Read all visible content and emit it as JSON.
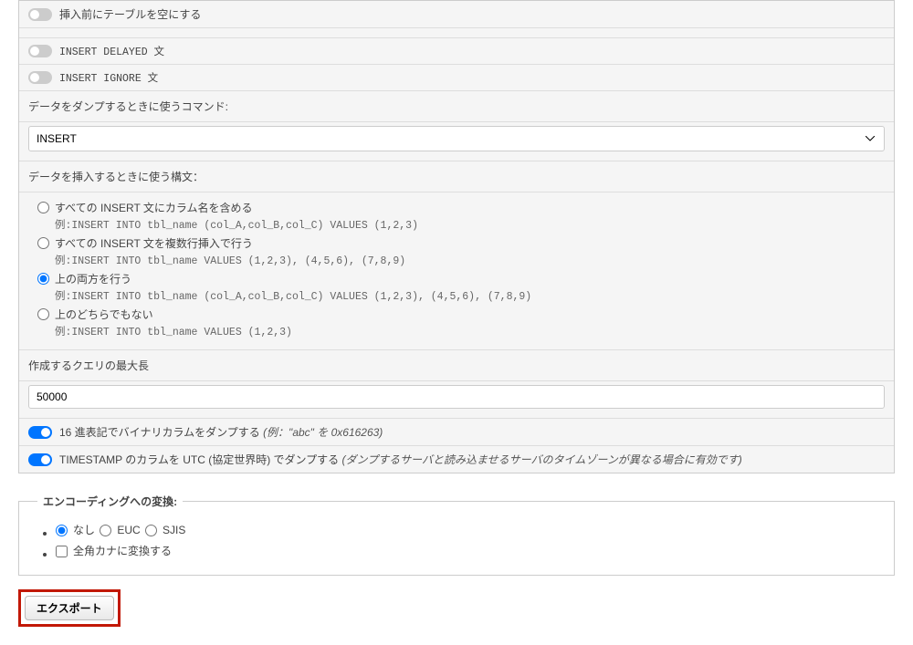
{
  "toggles": {
    "truncate_before": {
      "label": "挿入前にテーブルを空にする",
      "on": false
    },
    "insert_delayed": {
      "label": "INSERT DELAYED 文",
      "on": false
    },
    "insert_ignore": {
      "label": "INSERT IGNORE 文",
      "on": false
    },
    "hex_binary": {
      "label": "16 進表記でバイナリカラムをダンプする ",
      "hint": "(例：\"abc\" を 0x616263)",
      "on": true
    },
    "timestamp_utc": {
      "label": "TIMESTAMP のカラムを UTC (協定世界時) でダンプする ",
      "hint": "(ダンプするサーバと読み込ませるサーバのタイムゾーンが異なる場合に有効です)",
      "on": true
    }
  },
  "dump_command": {
    "label": "データをダンプするときに使うコマンド:",
    "value": "INSERT"
  },
  "insert_syntax": {
    "label": "データを挿入するときに使う構文：",
    "options": [
      {
        "id": "include_columns",
        "label": "すべての INSERT 文にカラム名を含める",
        "example_prefix": "例:",
        "example": "INSERT INTO tbl_name (col_A,col_B,col_C) VALUES (1,2,3)"
      },
      {
        "id": "multi_row",
        "label": "すべての INSERT 文を複数行挿入で行う",
        "example_prefix": "例:",
        "example": "INSERT INTO tbl_name VALUES (1,2,3), (4,5,6), (7,8,9)"
      },
      {
        "id": "both",
        "label": "上の両方を行う",
        "example_prefix": "例:",
        "example": "INSERT INTO tbl_name (col_A,col_B,col_C) VALUES (1,2,3), (4,5,6), (7,8,9)"
      },
      {
        "id": "neither",
        "label": "上のどちらでもない",
        "example_prefix": "例:",
        "example": "INSERT INTO tbl_name VALUES (1,2,3)"
      }
    ],
    "selected": "both"
  },
  "max_query_length": {
    "label": "作成するクエリの最大長",
    "value": "50000"
  },
  "encoding": {
    "legend": "エンコーディングへの変換:",
    "options": {
      "none": "なし",
      "euc": "EUC",
      "sjis": "SJIS"
    },
    "selected": "none",
    "kana_label": "全角カナに変換する",
    "kana_checked": false
  },
  "export_button": "エクスポート"
}
